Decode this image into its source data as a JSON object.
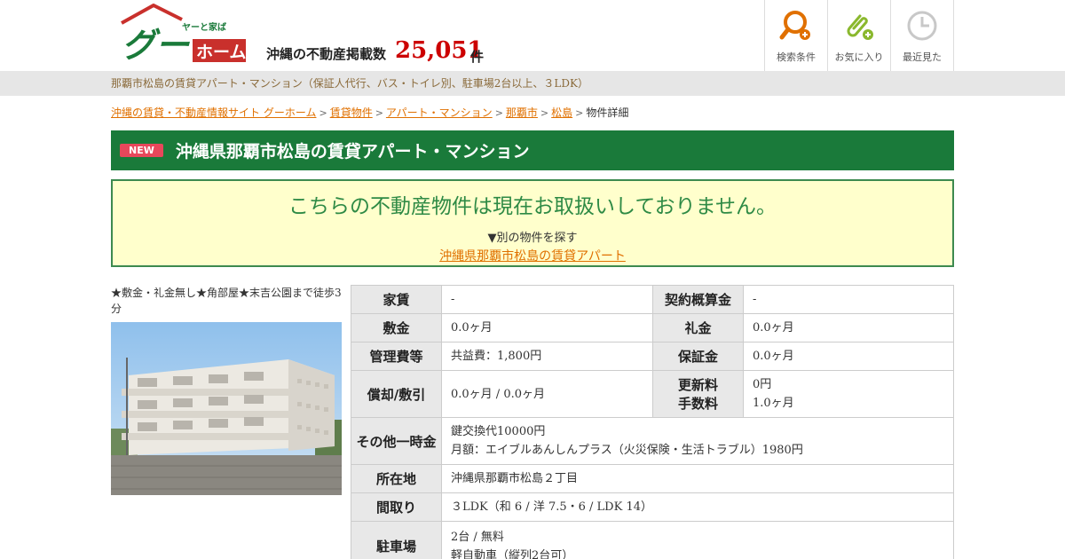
{
  "header": {
    "logo": {
      "tagline": "ヤーと家ば",
      "brand_a": "グー",
      "brand_b": "ホーム"
    },
    "count_label": "沖縄の不動産掲載数",
    "count_value": "25,051",
    "count_unit": "件",
    "nav": [
      {
        "label": "検索条件",
        "icon": "search-plus-icon"
      },
      {
        "label": "お気に入り",
        "icon": "paperclip-plus-icon"
      },
      {
        "label": "最近見た",
        "icon": "clock-icon"
      }
    ]
  },
  "subbar": {
    "text": "那覇市松島の賃貸アパート・マンション（保証人代行、バス・トイレ別、駐車場2台以上、３LDK）"
  },
  "breadcrumb": [
    {
      "label": "沖縄の賃貸・不動産情報サイト グーホーム",
      "link": true
    },
    {
      "label": "賃貸物件",
      "link": true
    },
    {
      "label": "アパート・マンション",
      "link": true
    },
    {
      "label": "那覇市",
      "link": true
    },
    {
      "label": "松島",
      "link": true
    },
    {
      "label": "物件詳細",
      "link": false
    }
  ],
  "title": {
    "badge": "NEW",
    "text": "沖縄県那覇市松島の賃貸アパート・マンション"
  },
  "notice": {
    "main": "こちらの不動産物件は現在お取扱いしておりません。",
    "sub": "▼別の物件を探す",
    "link": "沖縄県那覇市松島の賃貸アパート"
  },
  "property": {
    "catch_copy": "★敷金・礼金無し★角部屋★末吉公園まで徒歩3分",
    "colors": {
      "accent_green": "#1a7a3a",
      "new_badge": "#e8475b",
      "link_orange": "#e07000",
      "price_red": "#cc0000"
    }
  },
  "spec": {
    "rent_label": "家賃",
    "rent": "-",
    "contract_label": "契約概算金",
    "contract": "-",
    "deposit_label": "敷金",
    "deposit": "0.0ヶ月",
    "key_money_label": "礼金",
    "key_money": "0.0ヶ月",
    "mgmt_label": "管理費等",
    "mgmt": "共益費：1,800円",
    "guarantee_label": "保証金",
    "guarantee": "0.0ヶ月",
    "shokyaku_label": "償却/敷引",
    "shokyaku": "0.0ヶ月 / 0.0ヶ月",
    "renewal_label_1": "更新料",
    "renewal_label_2": "手数料",
    "renewal": "0円",
    "fee": "1.0ヶ月",
    "other_label": "その他一時金",
    "other_1": "鍵交換代10000円",
    "other_2": "月額：エイブルあんしんプラス（火災保険・生活トラブル）1980円",
    "address_label": "所在地",
    "address": "沖縄県那覇市松島２丁目",
    "layout_label": "間取り",
    "layout": "３LDK（和 6 / 洋 7.5・6 / LDK 14）",
    "parking_label": "駐車場",
    "parking_1": "2台 / 無料",
    "parking_2": "軽自動車（縦列2台可）"
  }
}
